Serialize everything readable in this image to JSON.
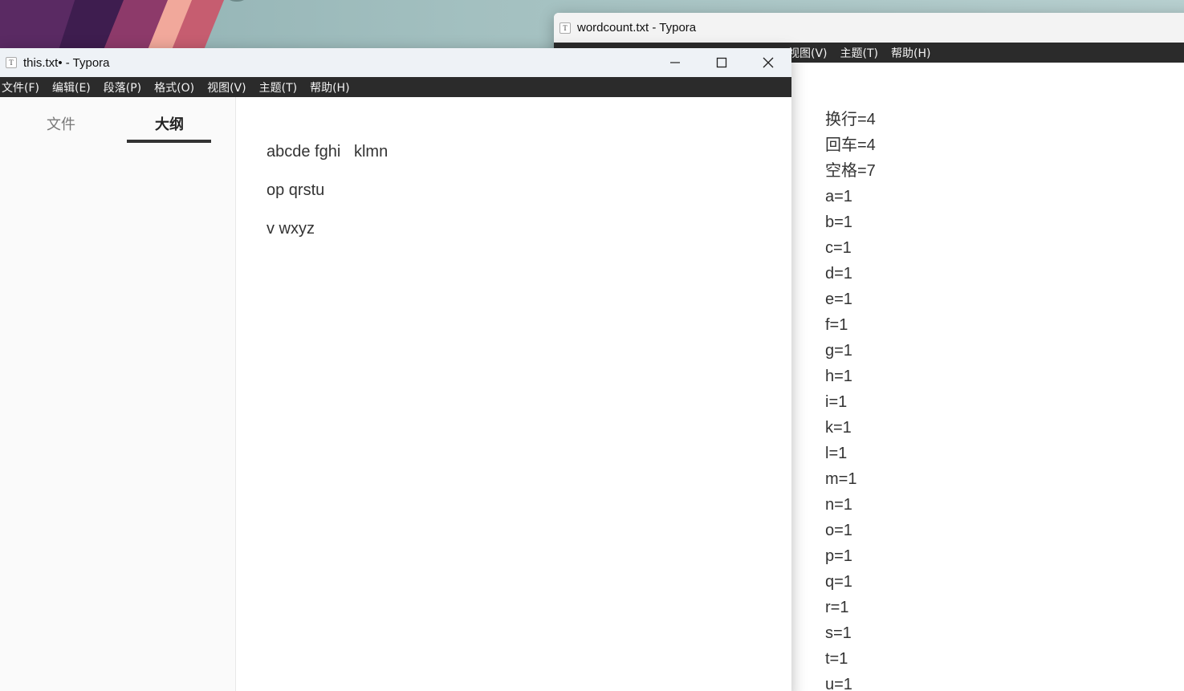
{
  "back_window": {
    "title": "wordcount.txt - Typora",
    "menu": [
      "视图(V)",
      "主题(T)",
      "帮助(H)"
    ],
    "counts": [
      "换行=4",
      "回车=4",
      "空格=7",
      "a=1",
      "b=1",
      "c=1",
      "d=1",
      "e=1",
      "f=1",
      "g=1",
      "h=1",
      "i=1",
      "k=1",
      "l=1",
      "m=1",
      "n=1",
      "o=1",
      "p=1",
      "q=1",
      "r=1",
      "s=1",
      "t=1",
      "u=1"
    ]
  },
  "front_window": {
    "title": "this.txt• - Typora",
    "menu": [
      "文件(F)",
      "编辑(E)",
      "段落(P)",
      "格式(O)",
      "视图(V)",
      "主题(T)",
      "帮助(H)"
    ],
    "sidebar_tabs": {
      "files": "文件",
      "outline": "大纲"
    },
    "paragraphs": [
      "abcde fghi   klmn",
      "op qrstu",
      "v wxyz"
    ]
  },
  "icons": {
    "app": "typora-icon",
    "minimize": "minimize-icon",
    "maximize": "maximize-icon",
    "close": "close-icon"
  }
}
